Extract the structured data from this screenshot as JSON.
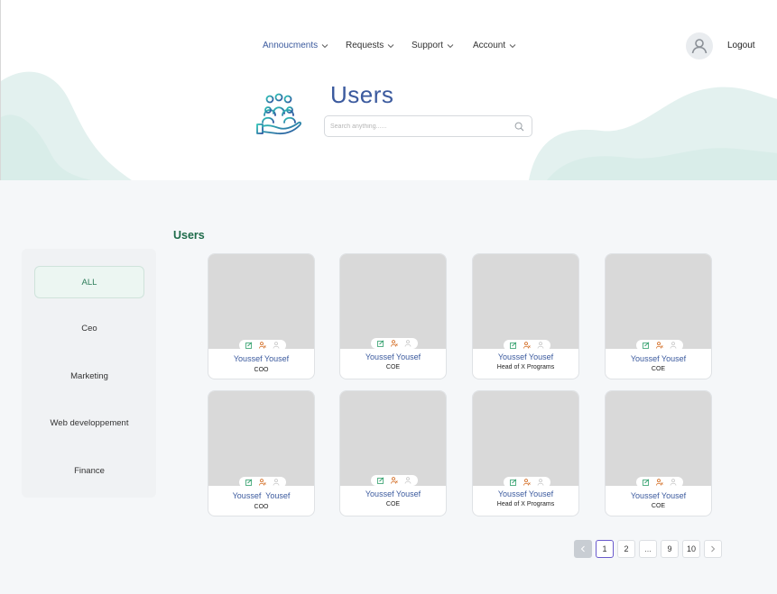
{
  "nav": {
    "items": [
      {
        "label": "Annoucments",
        "active": true
      },
      {
        "label": "Requests",
        "active": false
      },
      {
        "label": "Support",
        "active": false
      },
      {
        "label": "Account",
        "active": false
      }
    ],
    "logout_label": "Logout"
  },
  "header": {
    "title": "Users",
    "search_placeholder": "Search anything......"
  },
  "sidebar": {
    "items": [
      {
        "label": "ALL",
        "active": true
      },
      {
        "label": "Ceo",
        "active": false
      },
      {
        "label": "Marketing",
        "active": false
      },
      {
        "label": "Web developpement",
        "active": false
      },
      {
        "label": "Finance",
        "active": false
      }
    ]
  },
  "section_title": "Users",
  "cards": [
    {
      "name": "Youssef Yousef",
      "role": "COO"
    },
    {
      "name": "Youssef Yousef",
      "role": "COE"
    },
    {
      "name": "Youssef Yousef",
      "role": "Head of X Programs"
    },
    {
      "name": "Youssef Yousef",
      "role": "COE"
    },
    {
      "name": "Youssef  Yousef",
      "role": "COO"
    },
    {
      "name": "Youssef Yousef",
      "role": "COE"
    },
    {
      "name": "Youssef Yousef",
      "role": "Head of X Programs"
    },
    {
      "name": "Youssef Yousef",
      "role": "COE"
    }
  ],
  "card_action_icons": [
    "edit-icon",
    "remove-user-icon",
    "user-disabled-icon"
  ],
  "pagination": {
    "pages": [
      "1",
      "2",
      "...",
      "9",
      "10"
    ],
    "current": "1"
  },
  "colors": {
    "primary": "#3b5a9e",
    "accent_green": "#1e6b4a",
    "wave": "#e3f1ef"
  }
}
